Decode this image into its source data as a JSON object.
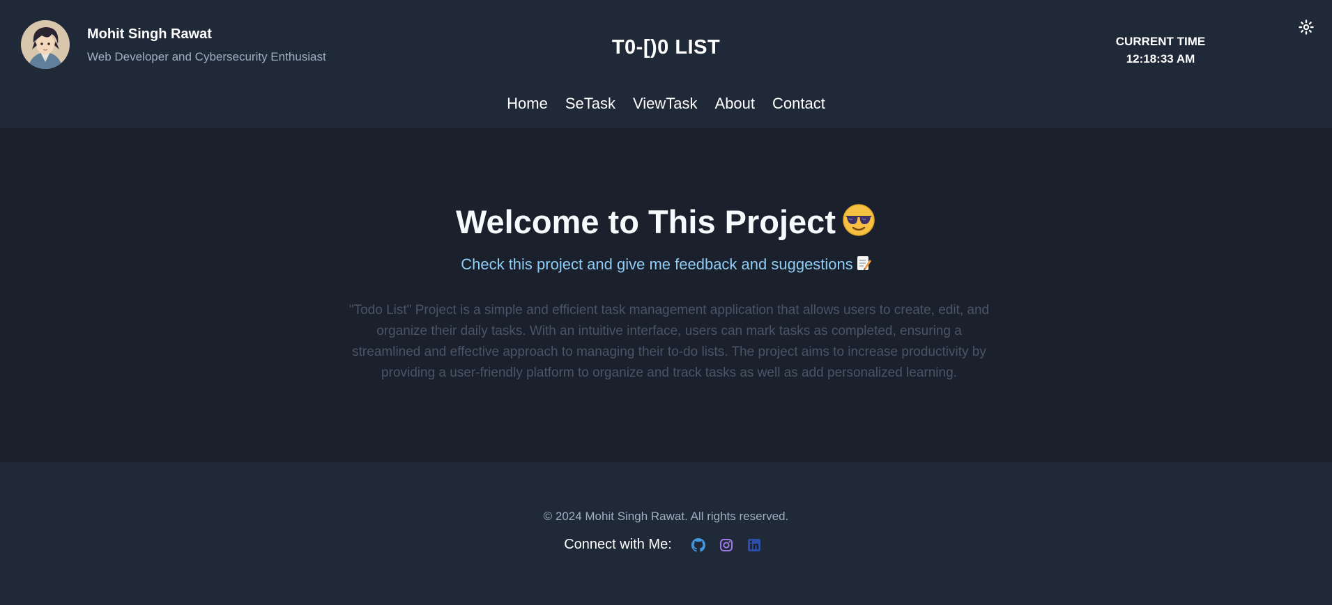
{
  "header": {
    "owner_name": "Mohit Singh Rawat",
    "owner_tagline": "Web Developer and Cybersecurity Enthusiast",
    "app_title": "T0-[)0 LIST",
    "clock_label": "CURRENT TIME",
    "clock_time": "12:18:33 AM",
    "theme_toggle_icon": "sun-icon"
  },
  "nav": {
    "items": [
      {
        "label": "Home"
      },
      {
        "label": "SeTask"
      },
      {
        "label": "ViewTask"
      },
      {
        "label": "About"
      },
      {
        "label": "Contact"
      }
    ]
  },
  "main": {
    "welcome": "Welcome to This Project",
    "welcome_emoji": "sunglasses-face-icon",
    "subtitle": "Check this project and give me feedback and suggestions",
    "subtitle_emoji": "memo-icon",
    "description": "\"Todo List\" Project is a simple and efficient task management application that allows users to create, edit, and organize their daily tasks. With an intuitive interface, users can mark tasks as completed, ensuring a streamlined and effective approach to managing their to-do lists. The project aims to increase productivity by providing a user-friendly platform to organize and track tasks as well as add personalized learning."
  },
  "footer": {
    "copyright": "© 2024 Mohit Singh Rawat. All rights reserved.",
    "connect_label": "Connect with Me:",
    "socials": [
      {
        "icon": "github-icon",
        "color": "#4299e1"
      },
      {
        "icon": "instagram-icon",
        "color": "#9f7aea"
      },
      {
        "icon": "linkedin-icon",
        "color": "#2b4fa8"
      }
    ]
  },
  "colors": {
    "header_bg": "#1f2937",
    "main_bg": "#1a202c",
    "subtitle": "#90cdf4",
    "description": "#4a5568",
    "muted": "#a0aec0"
  }
}
